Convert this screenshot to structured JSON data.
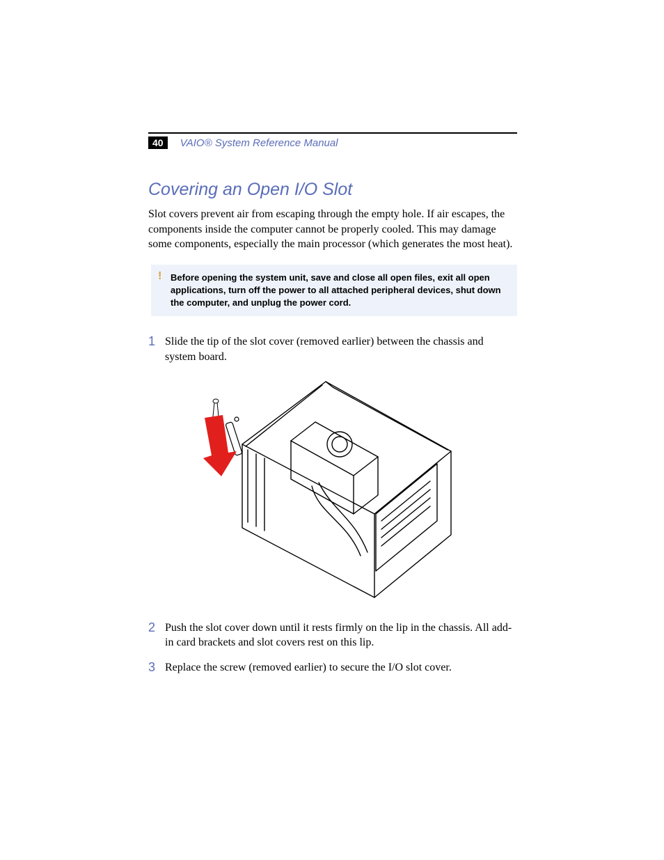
{
  "header": {
    "page_number": "40",
    "manual_title": "VAIO® System Reference Manual"
  },
  "section": {
    "heading": "Covering an Open I/O Slot",
    "intro": "Slot covers prevent air from escaping through the empty hole. If air escapes, the components inside the computer cannot be properly cooled. This may damage some components, especially the main processor (which generates the most heat)."
  },
  "warning": {
    "icon": "!",
    "text": "Before opening the system unit, save and close all open files, exit all open applications, turn off the power to all attached peripheral devices, shut down the computer, and unplug the power cord."
  },
  "steps": [
    {
      "num": "1",
      "text": "Slide the tip of the slot cover (removed earlier) between the chassis and system board."
    },
    {
      "num": "2",
      "text": "Push the slot cover down until it rests firmly on the lip in the chassis. All add-in card brackets and slot covers rest on this lip."
    },
    {
      "num": "3",
      "text": "Replace the screw (removed earlier) to secure the I/O slot cover."
    }
  ],
  "figure": {
    "alt": "computer-chassis-illustration"
  }
}
